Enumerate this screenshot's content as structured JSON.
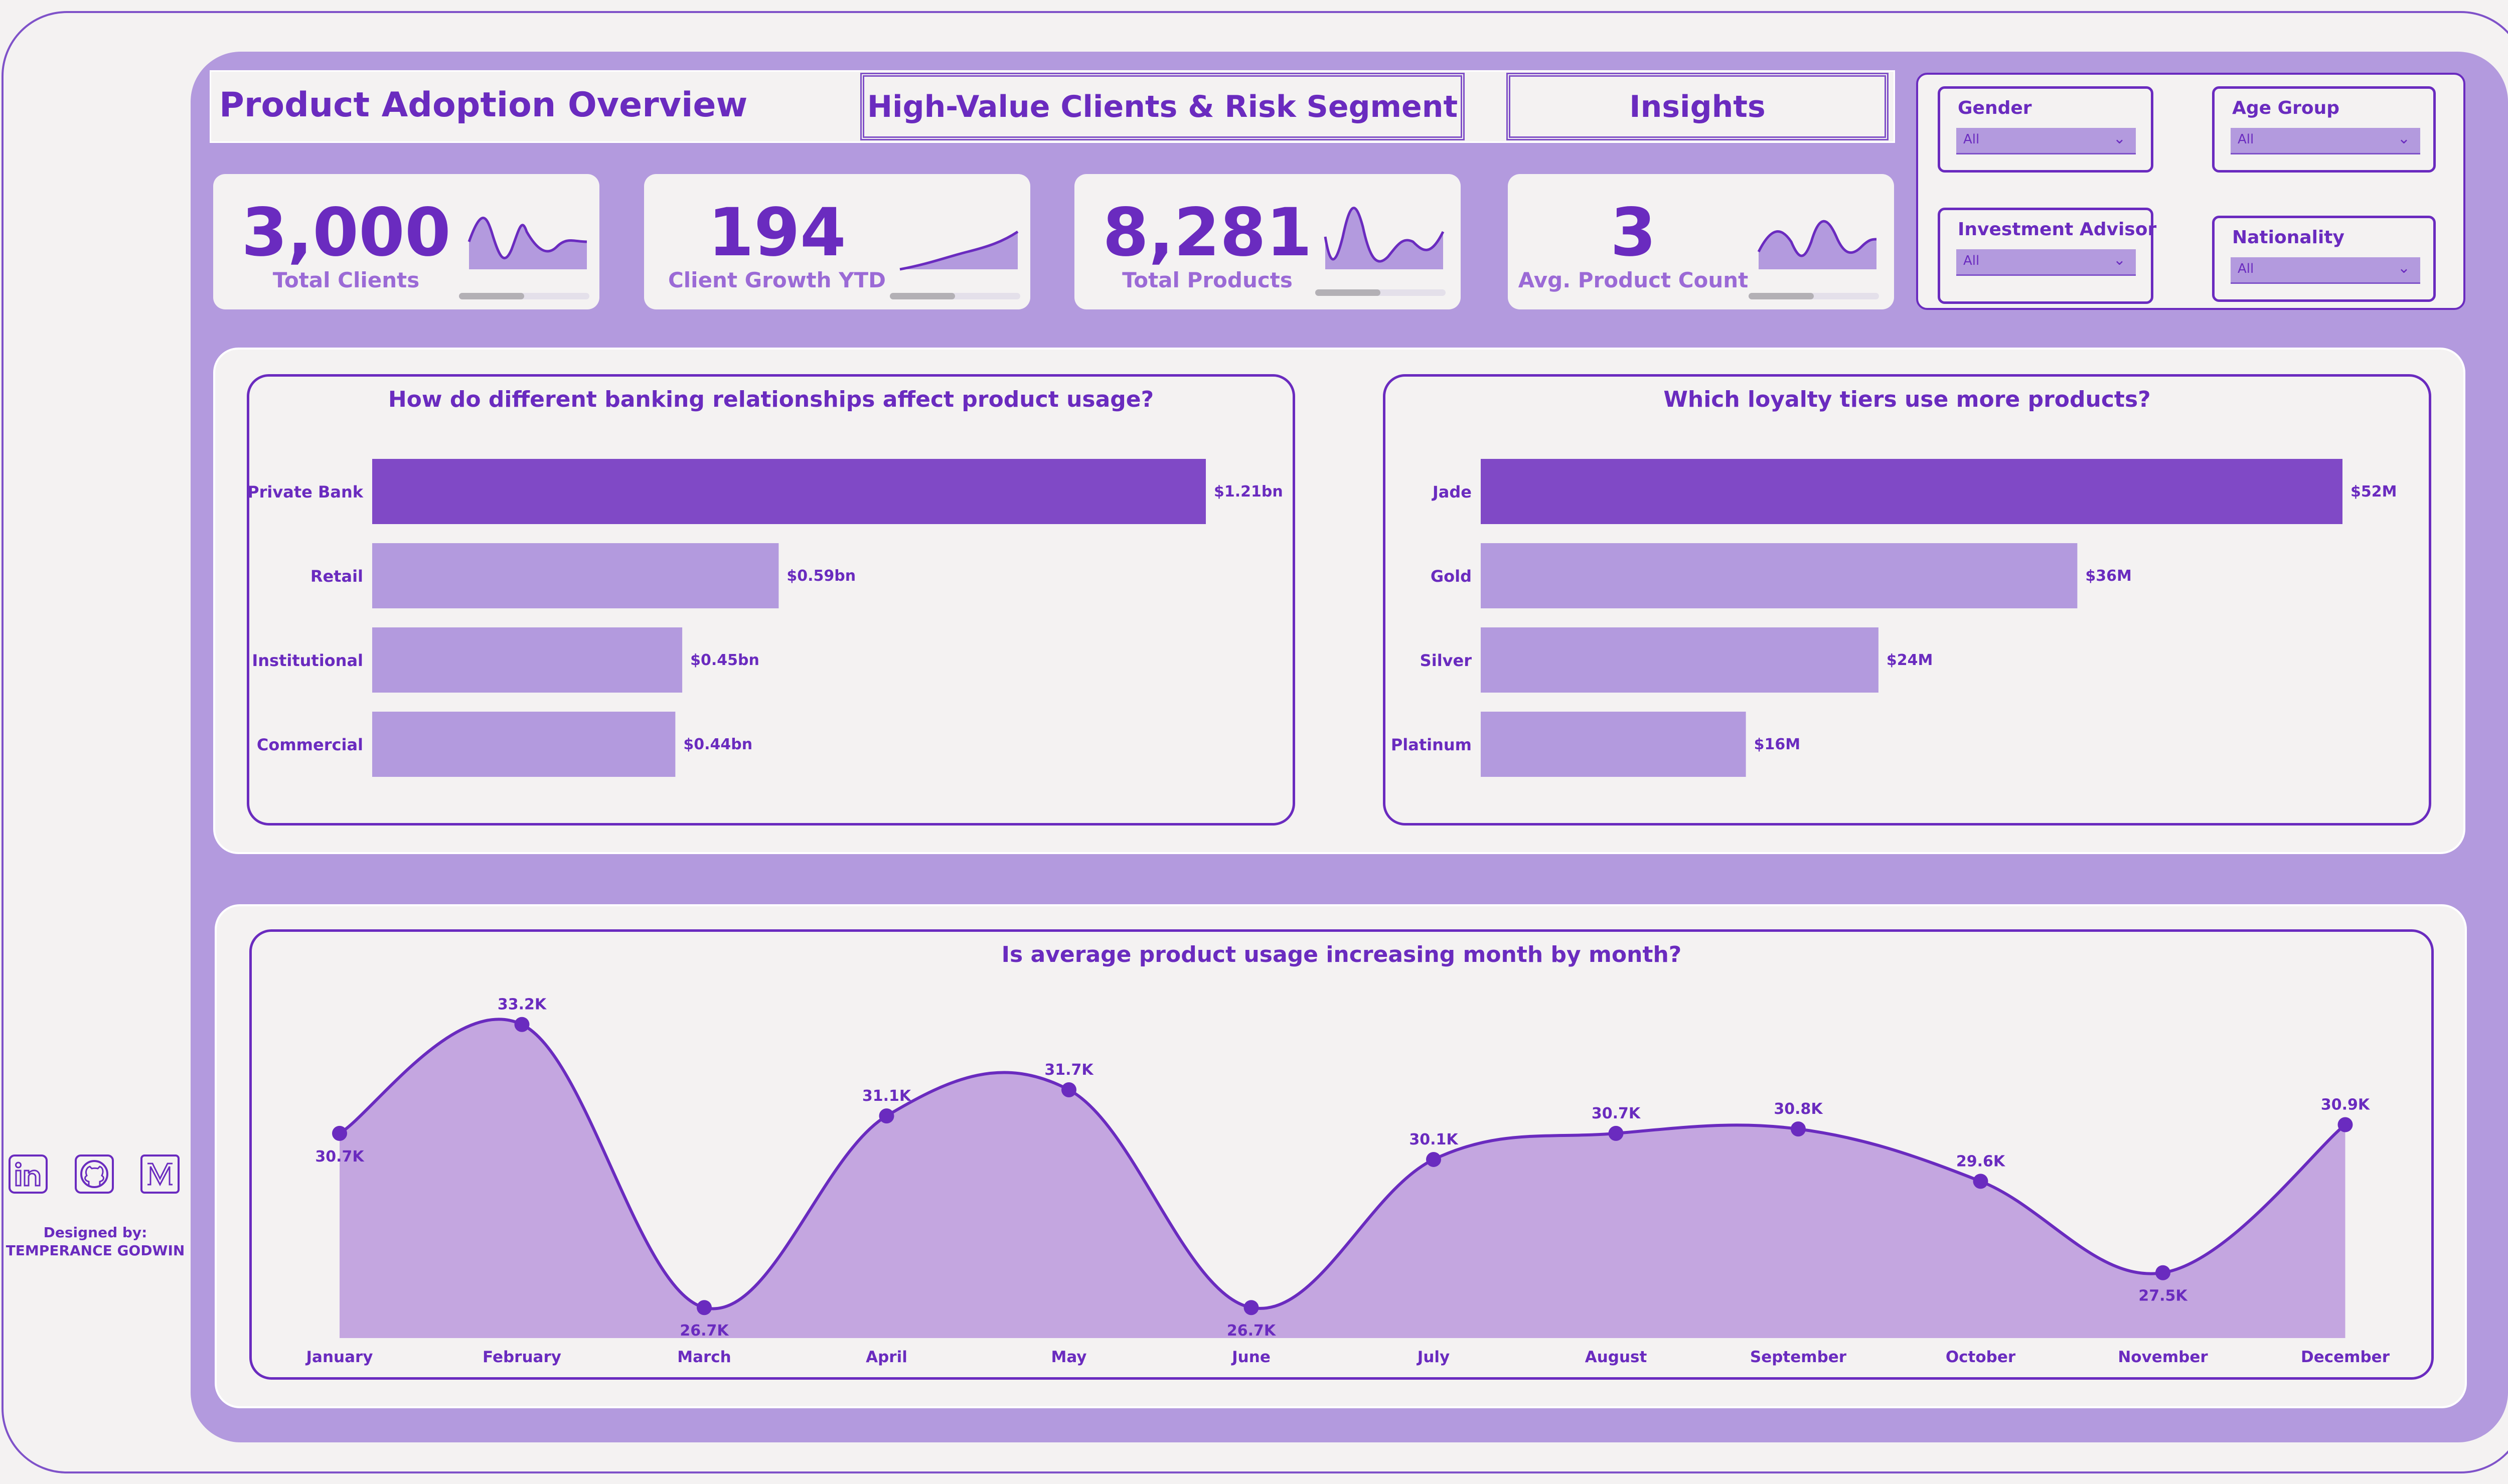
{
  "header": {
    "title": "Product Adoption Overview",
    "nav": [
      "High-Value Clients & Risk Segment",
      "Insights"
    ]
  },
  "kpis": [
    {
      "value": "3,000",
      "label": "Total Clients",
      "progress": 0.5
    },
    {
      "value": "194",
      "label": "Client Growth YTD",
      "progress": 0.5
    },
    {
      "value": "8,281",
      "label": "Total Products",
      "progress": 0.5
    },
    {
      "value": "3",
      "label": "Avg. Product Count",
      "progress": 0.5
    }
  ],
  "filters": [
    {
      "label": "Gender",
      "value": "All"
    },
    {
      "label": "Age Group",
      "value": "All"
    },
    {
      "label": "Investment Advisor",
      "value": "All"
    },
    {
      "label": "Nationality",
      "value": "All"
    }
  ],
  "colors": {
    "accent": "#6a2bbf",
    "bar_highlight": "#8049c6",
    "bar_normal": "#b39ade",
    "area_fill": "#c4a6e0",
    "panel": "#b39ade",
    "background": "#f4f2f2"
  },
  "chart_data": [
    {
      "type": "bar",
      "orientation": "horizontal",
      "title": "How do different banking relationships affect product usage?",
      "categories": [
        "Private Bank",
        "Retail",
        "Institutional",
        "Commercial"
      ],
      "values": [
        1.21,
        0.59,
        0.45,
        0.44
      ],
      "data_labels": [
        "$1.21bn",
        "$0.59bn",
        "$0.45bn",
        "$0.44bn"
      ],
      "xlim": [
        0,
        1.21
      ]
    },
    {
      "type": "bar",
      "orientation": "horizontal",
      "title": "Which loyalty tiers use more products?",
      "categories": [
        "Jade",
        "Gold",
        "Silver",
        "Platinum"
      ],
      "values": [
        52,
        36,
        24,
        16
      ],
      "data_labels": [
        "$52M",
        "$36M",
        "$24M",
        "$16M"
      ],
      "xlim": [
        0,
        52
      ]
    },
    {
      "type": "area",
      "title": "Is average product usage increasing month by month?",
      "categories": [
        "January",
        "February",
        "March",
        "April",
        "May",
        "June",
        "July",
        "August",
        "September",
        "October",
        "November",
        "December"
      ],
      "values": [
        30.7,
        33.2,
        26.7,
        31.1,
        31.7,
        26.7,
        30.1,
        30.7,
        30.8,
        29.6,
        27.5,
        30.9
      ],
      "data_labels": [
        "30.7K",
        "33.2K",
        "26.7K",
        "31.1K",
        "31.7K",
        "26.7K",
        "30.1K",
        "30.7K",
        "30.8K",
        "29.6K",
        "27.5K",
        "30.9K"
      ],
      "ylim": [
        26.0,
        33.6
      ]
    }
  ],
  "sidebar": {
    "social": [
      "linkedin-icon",
      "github-icon",
      "medium-icon"
    ],
    "designed_by_label": "Designed by:",
    "designer": "TEMPERANCE GODWIN"
  }
}
